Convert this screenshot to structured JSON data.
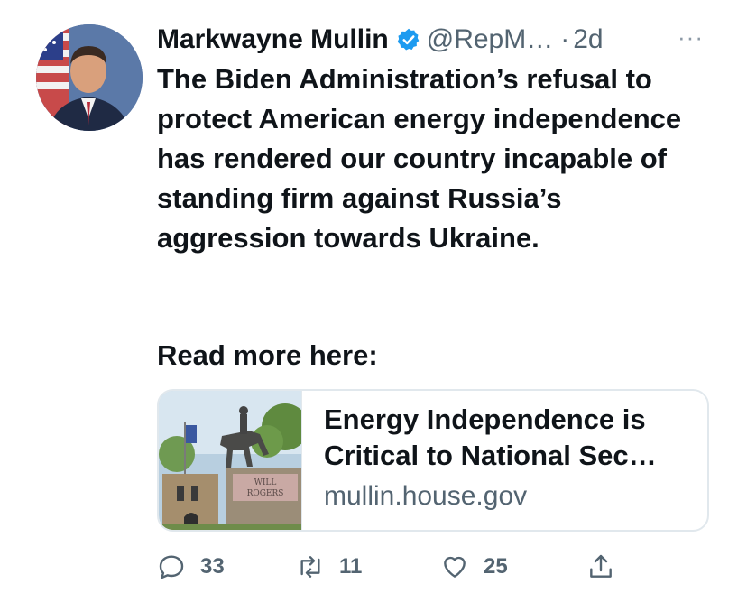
{
  "tweet": {
    "author_name": "Markwayne Mullin",
    "handle": "@RepM…",
    "separator": "·",
    "age": "2d",
    "more_label": "···",
    "text": "The Biden Administration’s refusal to protect American energy independence has rendered our country incapable of standing firm against Russia’s aggression towards Ukraine.",
    "read_more": "Read more here:",
    "verified_icon": "verified-badge-icon",
    "accent_color": "#1d9bf0"
  },
  "link_card": {
    "title": "Energy Independence is Critical to National Sec…",
    "domain": "mullin.house.gov",
    "thumbnail_sign_text": "WILL ROGERS"
  },
  "actions": {
    "reply_count": "33",
    "retweet_count": "11",
    "like_count": "25",
    "icons": [
      "reply-icon",
      "retweet-icon",
      "like-icon",
      "share-icon"
    ]
  }
}
